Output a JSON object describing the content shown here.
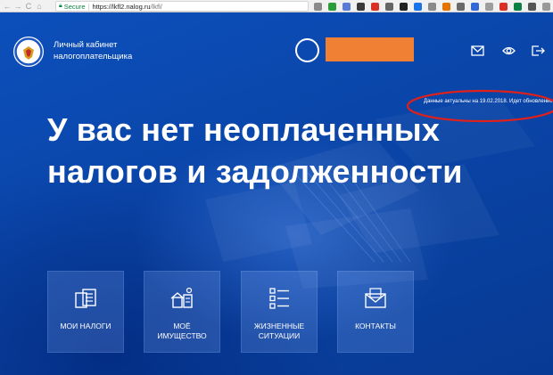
{
  "browser": {
    "back": "←",
    "forward": "→",
    "reload": "C",
    "home": "⌂",
    "secure_label": "Secure",
    "url_host": "https://lkfl2.nalog.ru",
    "url_path": "/lkfl/",
    "extension_colors": [
      "#8a8a8a",
      "#2a9d3a",
      "#5b7bd5",
      "#3a3a3a",
      "#d93025",
      "#666",
      "#222",
      "#1a73e8",
      "#8a8a8a",
      "#e37400",
      "#6a6a6a",
      "#3367d6",
      "#9e9e9e",
      "#d93025",
      "#0b8043",
      "#555",
      "#999",
      "#333"
    ]
  },
  "header": {
    "brand_line1": "Личный кабинет",
    "brand_line2": "налогоплательщика",
    "accent_orange": "#f08033"
  },
  "status": {
    "text": "Данные актуальны на 19.02.2018. Идет обновление",
    "annotation_color": "#e0201a"
  },
  "headline": {
    "line1": "У вас нет неоплаченных",
    "line2": "налогов и задолженности"
  },
  "tiles": [
    {
      "icon": "tax-documents-icon",
      "label": "Мои налоги"
    },
    {
      "icon": "property-icon",
      "label": "Моё имущество"
    },
    {
      "icon": "list-icon",
      "label": "Жизненные ситуации"
    },
    {
      "icon": "envelope-icon",
      "label": "Контакты"
    }
  ]
}
